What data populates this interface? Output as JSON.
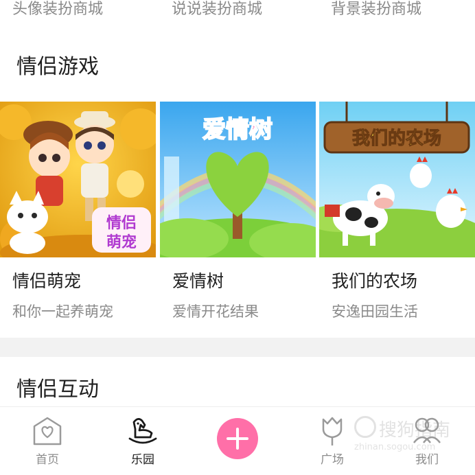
{
  "shop_links": [
    {
      "label": "头像装扮商城"
    },
    {
      "label": "说说装扮商城"
    },
    {
      "label": "背景装扮商城"
    }
  ],
  "sections": {
    "games_title": "情侣游戏",
    "interact_title": "情侣互动"
  },
  "games": [
    {
      "title": "情侣萌宠",
      "subtitle": "和你一起养萌宠",
      "art_text": "情侣萌宠"
    },
    {
      "title": "爱情树",
      "subtitle": "爱情开花结果",
      "art_text": "爱情树"
    },
    {
      "title": "我们的农场",
      "subtitle": "安逸田园生活",
      "art_text": "我们的农场"
    }
  ],
  "tabbar": {
    "items": [
      {
        "label": "首页",
        "icon": "home-heart-icon"
      },
      {
        "label": "乐园",
        "icon": "rocking-horse-icon",
        "active": true
      },
      {
        "label": "",
        "icon": "plus-icon"
      },
      {
        "label": "广场",
        "icon": "tulip-icon"
      },
      {
        "label": "我们",
        "icon": "couple-icon"
      }
    ],
    "accent": "#ff6fa8"
  },
  "watermark": {
    "text": "搜狗指南",
    "sub": "zhinan.sogou.com"
  }
}
